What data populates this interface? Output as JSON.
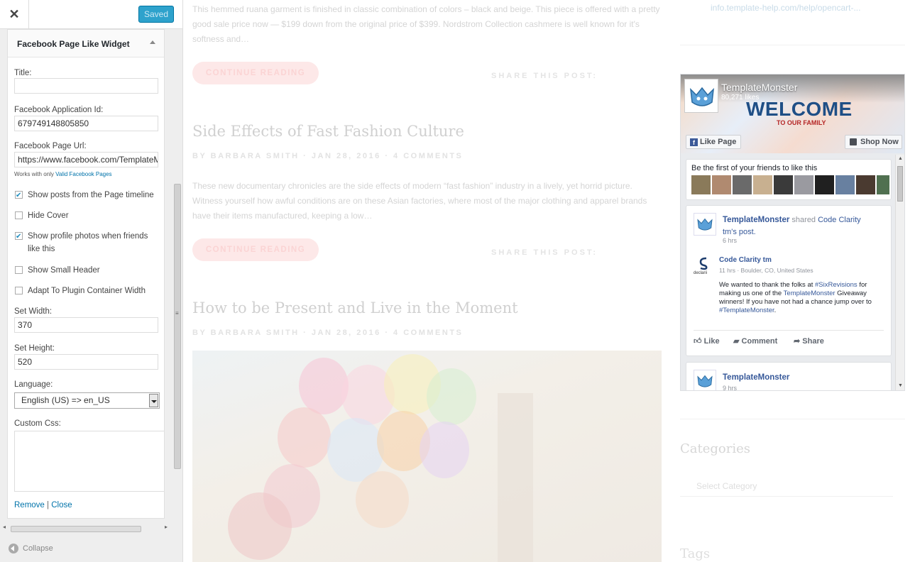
{
  "panel": {
    "close_glyph": "✕",
    "saved_label": "Saved",
    "collapse_label": "Collapse"
  },
  "widget": {
    "title": "Facebook Page Like Widget",
    "fields": {
      "title_label": "Title:",
      "title_value": "",
      "app_id_label": "Facebook Application Id:",
      "app_id_value": "679749148805850",
      "page_url_label": "Facebook Page Url:",
      "page_url_value": "https://www.facebook.com/TemplateMonster",
      "page_url_note": "Works with only ",
      "page_url_note_link": "Valid Facebook Pages",
      "set_width_label": "Set Width:",
      "set_width_value": "370",
      "set_height_label": "Set Height:",
      "set_height_value": "520",
      "language_label": "Language:",
      "language_value": "English (US) => en_US",
      "custom_css_label": "Custom Css:",
      "custom_css_value": ""
    },
    "checkboxes": [
      {
        "label": "Show posts from the Page timeline",
        "checked": true
      },
      {
        "label": "Hide Cover",
        "checked": false
      },
      {
        "label": "Show profile photos when friends like this",
        "checked": true
      },
      {
        "label": "Show Small Header",
        "checked": false
      },
      {
        "label": "Adapt To Plugin Container Width",
        "checked": false
      }
    ],
    "remove_label": "Remove",
    "separator": "|",
    "close_label": "Close"
  },
  "preview": {
    "post1_excerpt": "This hemmed ruana garment is finished in classic combination of colors – black and beige. This piece is offered with a pretty good sale price now — $199 down from the original price of $399.  Nordstrom Collection cashmere is well known for it's softness and…",
    "read_more": "CONTINUE READING",
    "share_label": "SHARE THIS POST:",
    "post2_title": "Side Effects of Fast Fashion Culture",
    "post2_meta": "BY  BARBARA SMITH  ·  JAN 28, 2016  ·  4 COMMENTS",
    "post2_excerpt": "These new documentary chronicles are the side effects of modern “fast fashion” industry in a lively, yet horrid picture. Witness yourself how awful conditions are on these Asian factories, where most of the major clothing and apparel brands have their items manufactured, keeping a low…",
    "post3_title": "How to be Present and Live in the Moment",
    "post3_meta": "BY  BARBARA SMITH  ·  JAN 28, 2016  ·  4 COMMENTS",
    "sidebar_link": "info.template-help.com/help/opencart-...",
    "categories_title": "Categories",
    "category_placeholder": "Select Category",
    "tags_title": "Tags"
  },
  "facebook": {
    "page_name": "TemplateMonster",
    "likes": "80,271 likes",
    "cover_welcome": "WELCOME",
    "cover_sub": "TO OUR FAMILY",
    "like_page": "Like Page",
    "shop_now": "Shop Now",
    "friends_prompt": "Be the first of your friends to like this",
    "post1": {
      "author": "TemplateMonster",
      "shared": " shared ",
      "shared_author": "Code Clarity tm",
      "shared_suffix": "'s post.",
      "time": "6 hrs",
      "inner_author": "Code Clarity tm",
      "inner_meta": "11 hrs · Boulder, CO, United States",
      "inner_text_1": "We wanted to thank the folks at ",
      "inner_tag_1": "#SixRevisions",
      "inner_text_2": " for making us one of the ",
      "inner_tag_2": "TemplateMonster",
      "inner_text_3": " Giveaway winners! If you have not had a chance jump over to ",
      "inner_tag_3": "#TemplateMonster",
      "inner_text_4": ".",
      "inner_logo_text": "declarii"
    },
    "actions": {
      "like": "Like",
      "comment": "Comment",
      "share": "Share"
    },
    "post2": {
      "author": "TemplateMonster",
      "time": "9 hrs"
    }
  },
  "colors": {
    "accent": "#2ea2cc",
    "fb_blue": "#365899",
    "link": "#0073aa"
  }
}
